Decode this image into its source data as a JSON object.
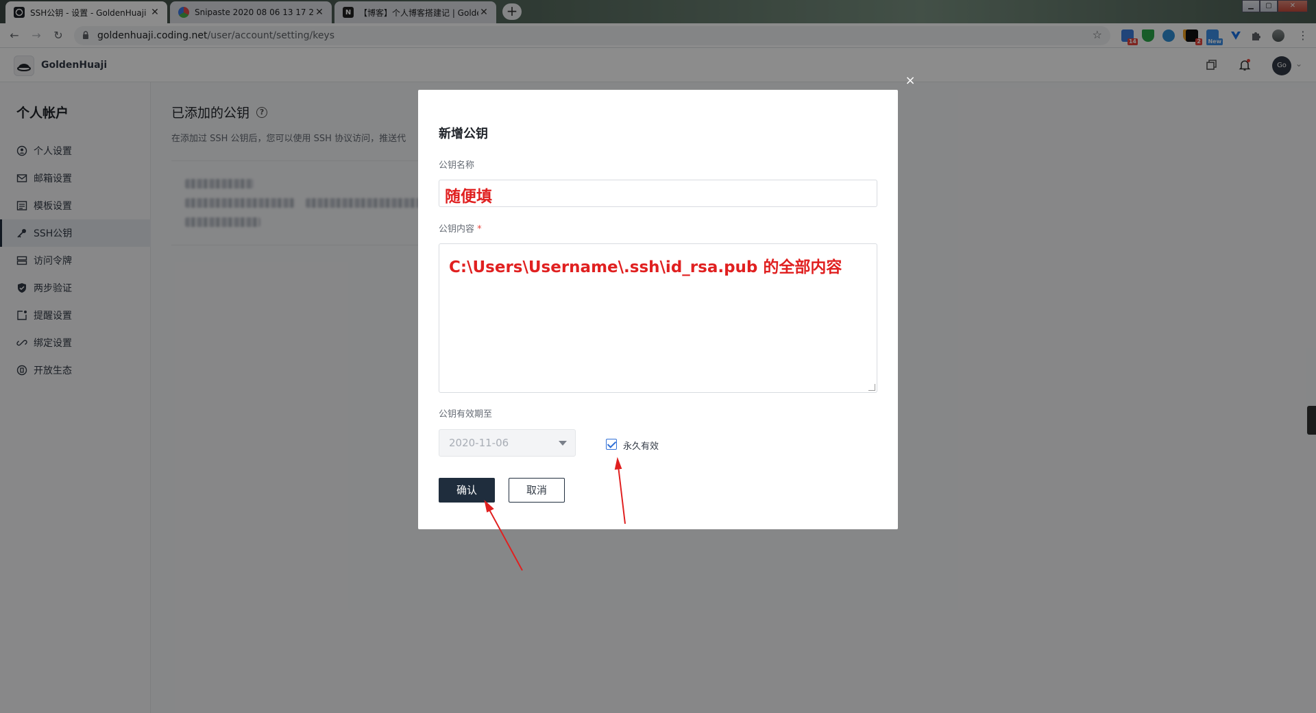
{
  "browser": {
    "tabs": [
      {
        "title": "SSH公钥 - 设置 - GoldenHuaji",
        "active": true
      },
      {
        "title": "Snipaste 2020 08 06 13 17 26",
        "active": false
      },
      {
        "title": "【博客】个人博客搭建记 | Golde",
        "active": false
      }
    ],
    "url": {
      "host": "goldenhuaji.coding.net",
      "path": "/user/account/setting/keys"
    },
    "extension_badges": {
      "ext1": "14",
      "ext5": "2",
      "ext6": "New"
    }
  },
  "header": {
    "brand": "GoldenHuaji",
    "avatar_text": "Go"
  },
  "sidebar": {
    "heading": "个人帐户",
    "items": [
      {
        "label": "个人设置",
        "icon": "user-icon"
      },
      {
        "label": "邮箱设置",
        "icon": "mail-icon"
      },
      {
        "label": "模板设置",
        "icon": "template-icon"
      },
      {
        "label": "SSH公钥",
        "icon": "key-icon",
        "active": true
      },
      {
        "label": "访问令牌",
        "icon": "token-icon"
      },
      {
        "label": "两步验证",
        "icon": "shield-icon"
      },
      {
        "label": "提醒设置",
        "icon": "reminder-icon"
      },
      {
        "label": "绑定设置",
        "icon": "link-icon"
      },
      {
        "label": "开放生态",
        "icon": "ecosystem-icon"
      }
    ]
  },
  "main": {
    "title": "已添加的公钥",
    "description": "在添加过 SSH 公钥后，您可以使用 SSH 协议访问，推送代"
  },
  "modal": {
    "title": "新增公钥",
    "name_label": "公钥名称",
    "name_value": "随便填",
    "content_label": "公钥内容",
    "required_mark": "*",
    "content_value": "C:\\Users\\Username\\.ssh\\id_rsa.pub 的全部内容",
    "expiry_label": "公钥有效期至",
    "expiry_value": "2020-11-06",
    "permanent_label": "永久有效",
    "permanent_checked": true,
    "confirm_label": "确认",
    "cancel_label": "取消",
    "close_glyph": "×"
  },
  "colors": {
    "primary": "#1f2d3d",
    "annotation": "#e02020",
    "checkbox": "#2f6fd6"
  }
}
